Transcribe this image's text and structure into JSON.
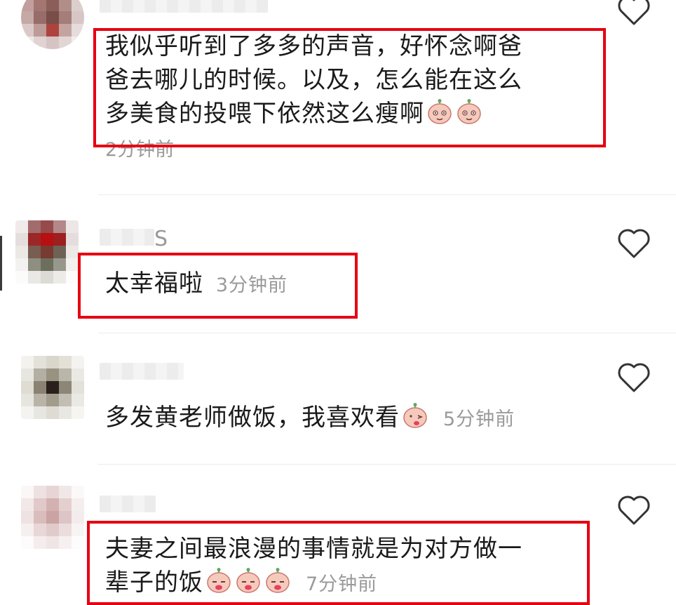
{
  "comments": [
    {
      "text_lines": [
        "我似乎听到了多多的声音，好怀念啊爸",
        "爸去哪儿的时候。以及，怎么能在这么",
        "多美食的投喂下依然这么瘦啊"
      ],
      "emoji_count": 2,
      "time": "2分钟前",
      "highlighted": true
    },
    {
      "username_suffix": "S",
      "text": "太幸福啦",
      "time": "3分钟前",
      "highlighted": true
    },
    {
      "text": "多发黄老师做饭，我喜欢看",
      "emoji_count": 1,
      "time": "5分钟前",
      "highlighted": false
    },
    {
      "text_lines": [
        "夫妻之间最浪漫的事情就是为对方做一",
        "辈子的饭"
      ],
      "emoji_count": 3,
      "time": "7分钟前",
      "highlighted": true
    }
  ],
  "icons": {
    "like": "heart-outline-icon",
    "emoji": "peach-face-emoji"
  },
  "colors": {
    "highlight": "#e60012",
    "time_text": "#9a9a9a",
    "divider": "#ececec"
  }
}
